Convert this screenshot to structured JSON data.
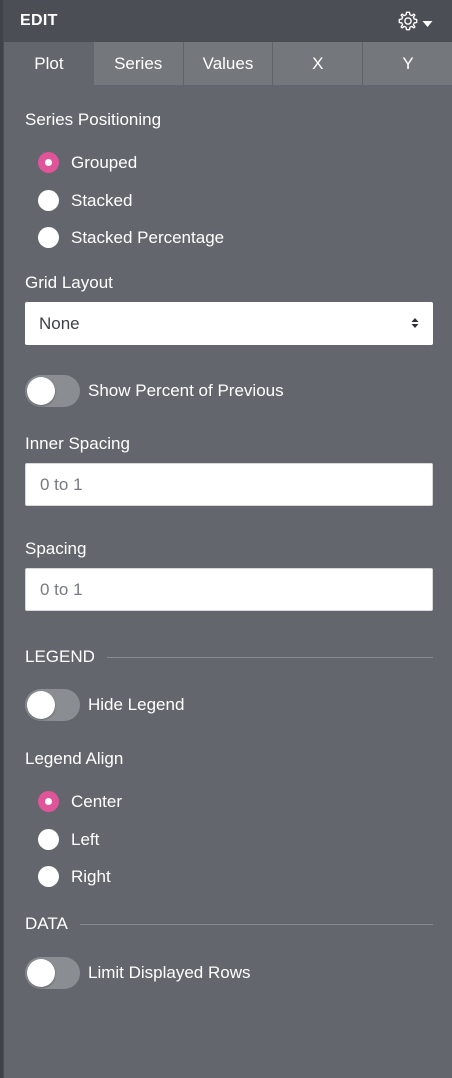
{
  "header": {
    "title": "EDIT",
    "settings_icon": "gear-icon",
    "dropdown_icon": "caret-down-icon"
  },
  "tabs": [
    {
      "label": "Plot",
      "active": true
    },
    {
      "label": "Series",
      "active": false
    },
    {
      "label": "Values",
      "active": false
    },
    {
      "label": "X",
      "active": false
    },
    {
      "label": "Y",
      "active": false
    }
  ],
  "series_positioning": {
    "label": "Series Positioning",
    "options": [
      {
        "label": "Grouped",
        "selected": true
      },
      {
        "label": "Stacked",
        "selected": false
      },
      {
        "label": "Stacked Percentage",
        "selected": false
      }
    ]
  },
  "grid_layout": {
    "label": "Grid Layout",
    "value": "None",
    "icon": "select-arrows-icon"
  },
  "show_percent": {
    "label": "Show Percent of Previous",
    "on": false
  },
  "inner_spacing": {
    "label": "Inner Spacing",
    "placeholder": "0 to 1",
    "value": ""
  },
  "spacing": {
    "label": "Spacing",
    "placeholder": "0 to 1",
    "value": ""
  },
  "legend_section": {
    "title": "LEGEND"
  },
  "hide_legend": {
    "label": "Hide Legend",
    "on": false
  },
  "legend_align": {
    "label": "Legend Align",
    "options": [
      {
        "label": "Center",
        "selected": true
      },
      {
        "label": "Left",
        "selected": false
      },
      {
        "label": "Right",
        "selected": false
      }
    ]
  },
  "data_section": {
    "title": "DATA"
  },
  "limit_rows": {
    "label": "Limit Displayed Rows",
    "on": false
  },
  "colors": {
    "accent": "#e0559a",
    "panel": "#63666c",
    "header": "#4b4e54",
    "tabs": "#74777c"
  }
}
